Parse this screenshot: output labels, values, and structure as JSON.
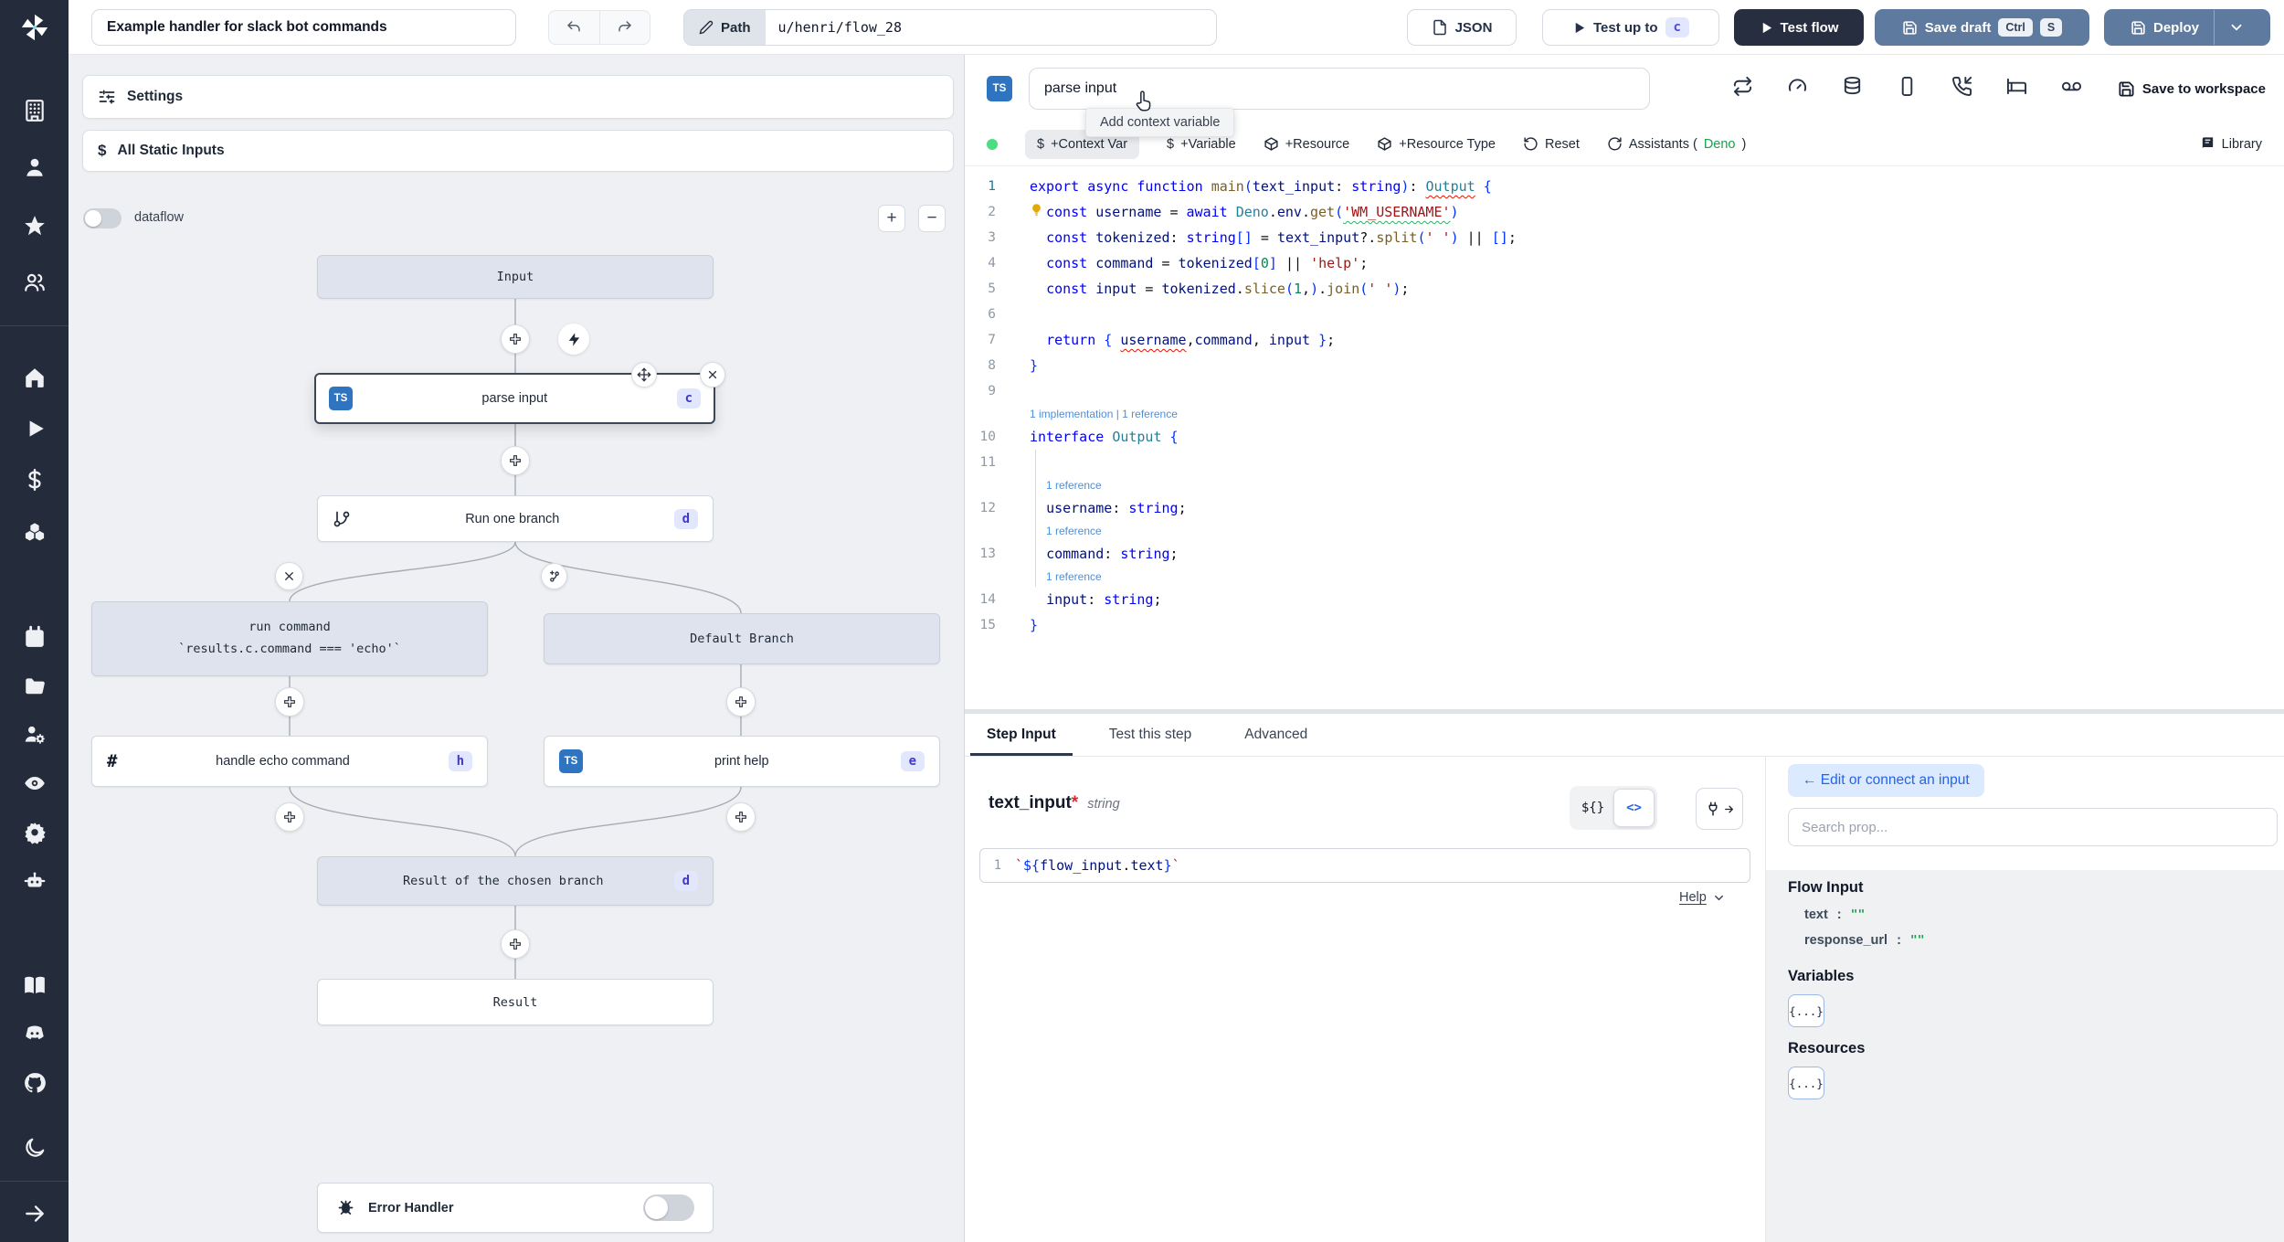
{
  "topbar": {
    "title": "Example handler for slack bot commands",
    "path_label": "Path",
    "path_value": "u/henri/flow_28",
    "json_button": "JSON",
    "test_up_to": "Test up to",
    "test_up_to_badge": "c",
    "test_flow": "Test flow",
    "save_draft": "Save draft",
    "kbd_ctrl": "Ctrl",
    "kbd_s": "S",
    "deploy": "Deploy"
  },
  "sidebar": {
    "icons": [
      "building",
      "user",
      "star",
      "users",
      "home",
      "play",
      "dollar",
      "boxes",
      "calendar",
      "folder",
      "user-cog",
      "eye",
      "settings",
      "bot",
      "book",
      "discord",
      "github",
      "moon",
      "arrow-right"
    ]
  },
  "flow": {
    "settings": "Settings",
    "all_static_inputs": "All Static Inputs",
    "dataflow": "dataflow",
    "zoom_in": "+",
    "zoom_out": "−",
    "nodes": {
      "input": {
        "label": "Input"
      },
      "parse_input": {
        "label": "parse input",
        "badge": "c",
        "lang": "TS"
      },
      "run_one_branch": {
        "label": "Run one branch",
        "badge": "d"
      },
      "run_command": {
        "label_line1": "run command",
        "label_line2": "`results.c.command === 'echo'`"
      },
      "default_branch": {
        "label": "Default Branch"
      },
      "handle_echo": {
        "label": "handle echo command",
        "badge": "h"
      },
      "print_help": {
        "label": "print help",
        "badge": "e",
        "lang": "TS"
      },
      "result_chosen": {
        "label": "Result of the chosen branch",
        "badge": "d"
      },
      "result": {
        "label": "Result"
      },
      "error_handler": {
        "label": "Error Handler"
      }
    }
  },
  "editor": {
    "lang_badge": "TS",
    "name_value": "parse input",
    "header_icons": [
      "repeat",
      "gauge",
      "database",
      "smartphone",
      "phone-incoming",
      "bed",
      "voicemail"
    ],
    "save_to_workspace": "Save to workspace",
    "toolbar": {
      "dollar": "$",
      "context_var": "+Context Var",
      "variable": "+Variable",
      "resource": "+Resource",
      "resource_type": "+Resource Type",
      "reset": "Reset",
      "assistants_prefix": "Assistants (",
      "assistants_runtime": "Deno",
      "assistants_suffix": ")",
      "library": "Library"
    },
    "tooltip": "Add context variable",
    "lines": [
      {
        "n": 1,
        "tokens": [
          [
            "k",
            "export"
          ],
          [
            "p",
            " "
          ],
          [
            "k",
            "async"
          ],
          [
            "p",
            " "
          ],
          [
            "k",
            "function"
          ],
          [
            "p",
            " "
          ],
          [
            "f",
            "main"
          ],
          [
            "b",
            "("
          ],
          [
            "v",
            "text_input"
          ],
          [
            "p",
            ": "
          ],
          [
            "k",
            "string"
          ],
          [
            "b",
            ")"
          ],
          [
            "p",
            ": "
          ],
          [
            "t.r",
            "Output"
          ],
          [
            "p",
            " "
          ],
          [
            "b",
            "{"
          ]
        ]
      },
      {
        "n": 2,
        "bulb": true,
        "tokens": [
          [
            "k",
            "const"
          ],
          [
            "p",
            " "
          ],
          [
            "v",
            "username"
          ],
          [
            "p",
            " = "
          ],
          [
            "k",
            "await"
          ],
          [
            "p",
            " "
          ],
          [
            "t",
            "Deno"
          ],
          [
            "p",
            "."
          ],
          [
            "v",
            "env"
          ],
          [
            "p",
            "."
          ],
          [
            "f",
            "get"
          ],
          [
            "b",
            "("
          ],
          [
            "s.g",
            "'WM_USERNAME'"
          ],
          [
            "b",
            ")"
          ]
        ]
      },
      {
        "n": 3,
        "tokens": [
          [
            "p",
            "  "
          ],
          [
            "k",
            "const"
          ],
          [
            "p",
            " "
          ],
          [
            "v",
            "tokenized"
          ],
          [
            "p",
            ": "
          ],
          [
            "k",
            "string"
          ],
          [
            "b",
            "[]"
          ],
          [
            "p",
            " = "
          ],
          [
            "v",
            "text_input"
          ],
          [
            "p",
            "?."
          ],
          [
            "f",
            "split"
          ],
          [
            "b",
            "("
          ],
          [
            "s",
            "' '"
          ],
          [
            "b",
            ")"
          ],
          [
            "p",
            " || "
          ],
          [
            "b",
            "[]"
          ],
          [
            "p",
            ";"
          ]
        ]
      },
      {
        "n": 4,
        "tokens": [
          [
            "p",
            "  "
          ],
          [
            "k",
            "const"
          ],
          [
            "p",
            " "
          ],
          [
            "v",
            "command"
          ],
          [
            "p",
            " = "
          ],
          [
            "v",
            "tokenized"
          ],
          [
            "b",
            "["
          ],
          [
            "n",
            "0"
          ],
          [
            "b",
            "]"
          ],
          [
            "p",
            " || "
          ],
          [
            "s",
            "'help'"
          ],
          [
            "p",
            ";"
          ]
        ]
      },
      {
        "n": 5,
        "tokens": [
          [
            "p",
            "  "
          ],
          [
            "k",
            "const"
          ],
          [
            "p",
            " "
          ],
          [
            "v",
            "input"
          ],
          [
            "p",
            " = "
          ],
          [
            "v",
            "tokenized"
          ],
          [
            "p",
            "."
          ],
          [
            "f",
            "slice"
          ],
          [
            "b",
            "("
          ],
          [
            "n",
            "1"
          ],
          [
            "p",
            ","
          ],
          [
            "b",
            ")"
          ],
          [
            "p",
            "."
          ],
          [
            "f",
            "join"
          ],
          [
            "b",
            "("
          ],
          [
            "s",
            "' '"
          ],
          [
            "b",
            ")"
          ],
          [
            "p",
            ";"
          ]
        ]
      },
      {
        "n": 6,
        "tokens": []
      },
      {
        "n": 7,
        "tokens": [
          [
            "p",
            "  "
          ],
          [
            "k",
            "return"
          ],
          [
            "p",
            " "
          ],
          [
            "b",
            "{"
          ],
          [
            "p",
            " "
          ],
          [
            "v.r",
            "username"
          ],
          [
            "p",
            ","
          ],
          [
            "v",
            "command"
          ],
          [
            "p",
            ", "
          ],
          [
            "v",
            "input"
          ],
          [
            "p",
            " "
          ],
          [
            "b",
            "}"
          ],
          [
            "p",
            ";"
          ]
        ]
      },
      {
        "n": 8,
        "tokens": [
          [
            "b",
            "}"
          ]
        ]
      },
      {
        "n": 9,
        "tokens": []
      },
      {
        "n": 10,
        "lens": "1 implementation | 1 reference",
        "tokens": [
          [
            "k",
            "interface"
          ],
          [
            "p",
            " "
          ],
          [
            "t",
            "Output"
          ],
          [
            "p",
            " "
          ],
          [
            "b",
            "{"
          ]
        ]
      },
      {
        "n": 11,
        "tokens": []
      },
      {
        "n": 12,
        "lens": "1 reference",
        "lens_ind": true,
        "tokens": [
          [
            "p",
            "  "
          ],
          [
            "v",
            "username"
          ],
          [
            "p",
            ": "
          ],
          [
            "k",
            "string"
          ],
          [
            "p",
            ";"
          ]
        ]
      },
      {
        "n": 13,
        "lens": "1 reference",
        "lens_ind": true,
        "tokens": [
          [
            "p",
            "  "
          ],
          [
            "v",
            "command"
          ],
          [
            "p",
            ": "
          ],
          [
            "k",
            "string"
          ],
          [
            "p",
            ";"
          ]
        ]
      },
      {
        "n": 14,
        "lens": "1 reference",
        "lens_ind": true,
        "tokens": [
          [
            "p",
            "  "
          ],
          [
            "v",
            "input"
          ],
          [
            "p",
            ": "
          ],
          [
            "k",
            "string"
          ],
          [
            "p",
            ";"
          ]
        ]
      },
      {
        "n": 15,
        "tokens": [
          [
            "b",
            "}"
          ]
        ]
      }
    ]
  },
  "bottom": {
    "tabs": [
      {
        "label": "Step Input"
      },
      {
        "label": "Test this step"
      },
      {
        "label": "Advanced"
      }
    ],
    "field_name": "text_input",
    "field_required": "*",
    "field_type": "string",
    "toggle_interp": "${}",
    "toggle_code": "<>",
    "input_line_number": "1",
    "input_tokens": [
      [
        "s",
        "`"
      ],
      [
        "b",
        "${"
      ],
      [
        "v",
        "flow_input"
      ],
      [
        "p",
        "."
      ],
      [
        "v",
        "text"
      ],
      [
        "b",
        "}"
      ],
      [
        "s",
        "`"
      ]
    ],
    "help": "Help"
  },
  "right_panel": {
    "edit_connect": "← Edit or connect an input",
    "search_placeholder": "Search prop...",
    "flow_input": "Flow Input",
    "props": [
      {
        "key": "text",
        "value": "\"\""
      },
      {
        "key": "response_url",
        "value": "\"\""
      }
    ],
    "variables": "Variables",
    "variables_value": "{...}",
    "resources": "Resources",
    "resources_value": "{...}"
  },
  "colors": {
    "sidebar_bg": "#242b3a",
    "ts_blue": "#2f74c0",
    "badge_bg": "#e3e7fd",
    "badge_text": "#4338ca",
    "slate_button": "#5e7a9e",
    "dark_button": "#272e3f",
    "green_dot": "#4ade80",
    "deno_green": "#16a34a",
    "edit_connect_bg": "#dbeafe",
    "edit_connect_text": "#2563eb"
  }
}
